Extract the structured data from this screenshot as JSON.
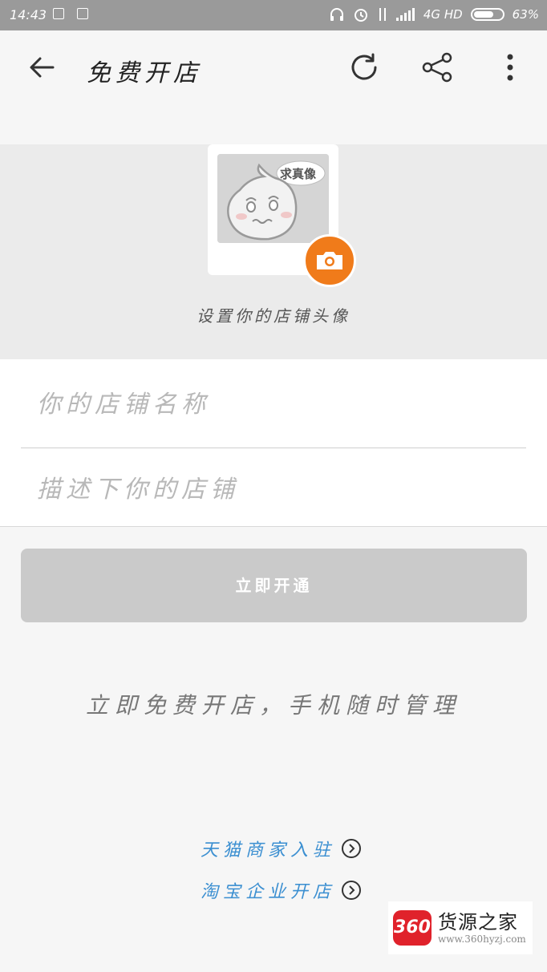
{
  "status_bar": {
    "time": "14:43",
    "network": "4G HD",
    "battery": "63%",
    "battery_level": 0.63
  },
  "toolbar": {
    "title": "免费开店",
    "back_icon": "back-arrow-icon",
    "refresh_icon": "refresh-icon",
    "share_icon": "share-icon",
    "more_icon": "more-vertical-icon"
  },
  "avatar": {
    "bubble_text": "求真像",
    "caption": "设置你的店铺头像",
    "camera_icon": "camera-icon",
    "camera_color": "#f07b1a"
  },
  "form": {
    "shop_name_placeholder": "你的店铺名称",
    "shop_name_value": "",
    "description_placeholder": "描述下你的店铺",
    "description_value": ""
  },
  "submit": {
    "label": "立即开通"
  },
  "slogan": "立即免费开店，手机随时管理",
  "links": {
    "tmall": "天猫商家入驻",
    "taobao_enterprise": "淘宝企业开店",
    "link_color": "#3b8fd1"
  },
  "watermark": {
    "logo": "360",
    "title": "货源之家",
    "url": "www.360hyzj.com"
  }
}
